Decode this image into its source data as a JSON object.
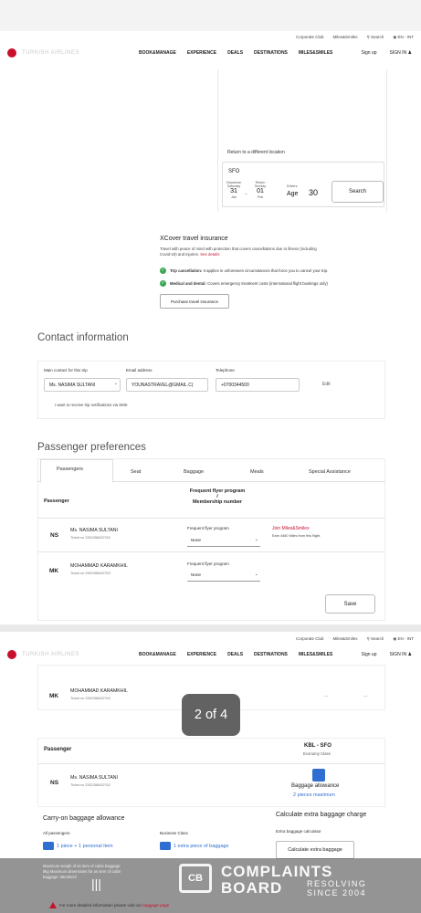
{
  "header": {
    "utility": [
      "Corporate Club",
      "Miles&Smiles",
      "Search",
      "EN - INT"
    ],
    "logo_text": "TURKISH AIRLINES",
    "nav": [
      "BOOK&MANAGE",
      "EXPERIENCE",
      "DEALS",
      "DESTINATIONS",
      "MILES&SMILES"
    ],
    "signup": "Sign up",
    "signin": "SIGN IN"
  },
  "car_search": {
    "return_label": "Return to a different location",
    "location": "SFO",
    "departure": {
      "label": "Departure",
      "day": "Saturday",
      "date": "31",
      "month": "Jan"
    },
    "return": {
      "label": "Return",
      "day": "Sunday",
      "date": "01",
      "month": "Feb"
    },
    "drivers_label": "Drivers",
    "age_label": "Age",
    "age_value": "30",
    "search_button": "Search"
  },
  "xcover": {
    "title": "XCover travel insurance",
    "desc_line1": "Travel with peace of mind with protection that covers cancellations due to illness (including",
    "desc_line2": "Covid-19) and injuries.",
    "see_details": "See details",
    "item1_bold": "Trip cancellation:",
    "item1_text": "It applies in unforeseen circumstances that force you to cancel your trip.",
    "item2_bold": "Medical and dental:",
    "item2_text": "Covers emergency treatment costs (international flight bookings only)",
    "purchase_button": "Purchase travel insurance"
  },
  "contact": {
    "title": "Contact information",
    "main_contact_label": "Main contact for this trip",
    "main_contact_value": "Ms. NASIMA SULTANI",
    "email_label": "Email address",
    "email_value": "YOUNASTRAVEL@GMAIL.C(",
    "phone_label": "Telephone",
    "phone_value": "+0700344500",
    "edit": "Edit",
    "sms": "I want to receive trip notifications via SMS"
  },
  "preferences": {
    "title": "Passenger preferences",
    "tabs": [
      "Passengers",
      "Seat",
      "Baggage",
      "Meals",
      "Special Assistance"
    ],
    "col_passenger": "Passenger",
    "col_ff_line1": "Frequent flyer program",
    "col_ff_line2": "/",
    "col_ff_line3": "Membership number",
    "passengers": [
      {
        "initials": "NS",
        "name": "Ms. NASIMA SULTANI",
        "ticket": "Ticket no 2352288432762",
        "ff_label": "Frequent flyer program",
        "ff_value": "None",
        "join": "Join Miles&Smiles",
        "earn": "Earn 4460 Miles from this flight."
      },
      {
        "initials": "MK",
        "name": "MOHAMMAD KARAMKHIL",
        "ticket": "Ticket no 2352288432763",
        "ff_label": "Frequent flyer program",
        "ff_value": "None"
      }
    ],
    "save_button": "Save"
  },
  "screen2": {
    "row_initials": "MK",
    "row_name": "MOHAMMAD KARAMKHIL",
    "row_ticket": "Ticket no 2352288432763",
    "row_dots1": "...",
    "row_dots2": "...",
    "counter": "2 of 4",
    "passenger_label": "Passenger",
    "route": "KBL - SFO",
    "cabin": "Economy Class",
    "ns_initials": "NS",
    "ns_name": "Ms. NASIMA SULTANI",
    "ns_ticket": "Ticket no 2352288432762",
    "baggage_allowance": "Baggage allowance",
    "baggage_pieces": "2 pieces maximum",
    "carry_title": "Carry-on baggage allowance",
    "calc_title": "Calculate extra baggage charge",
    "all_passengers": "All passengers",
    "business_class": "Business Class",
    "allowance1": "1 piece + 1 personal item",
    "allowance2": "1 extra piece of baggage",
    "calc_sub": "Extra baggage calculator",
    "calc_button": "Calculate extra baggage",
    "note1": "Maximum weight of an item of cabin baggage:",
    "note2": "8kg Maximum dimensions for an item of cabin",
    "note3": "baggage: 55x40x23",
    "warning": "For more detailed information please visit our",
    "warning_link": "baggage page"
  },
  "watermark": {
    "logo": "CB",
    "line1": "COMPLAINTS",
    "line2": "BOARD",
    "tag1": "RESOLVING",
    "tag2": "SINCE 2004"
  }
}
